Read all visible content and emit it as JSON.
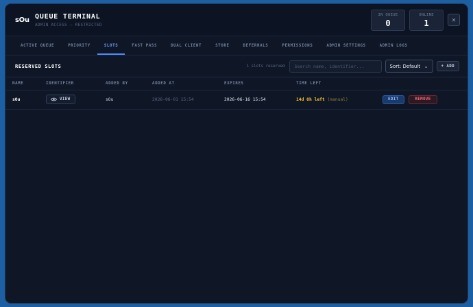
{
  "header": {
    "logo": "sOu",
    "title": "QUEUE TERMINAL",
    "subtitle": "ADMIN ACCESS — RESTRICTED",
    "stats": [
      {
        "label": "IN QUEUE",
        "value": "0"
      },
      {
        "label": "ONLINE",
        "value": "1"
      }
    ],
    "close_glyph": "✕"
  },
  "tabs": [
    {
      "label": "ACTIVE QUEUE",
      "active": false
    },
    {
      "label": "PRIORITY",
      "active": false
    },
    {
      "label": "SLOTS",
      "active": true
    },
    {
      "label": "FAST PASS",
      "active": false
    },
    {
      "label": "DUAL CLIENT",
      "active": false
    },
    {
      "label": "STORE",
      "active": false
    },
    {
      "label": "DEFERRALS",
      "active": false
    },
    {
      "label": "PERMISSIONS",
      "active": false
    },
    {
      "label": "ADMIN SETTINGS",
      "active": false
    },
    {
      "label": "ADMIN LOGS",
      "active": false
    }
  ],
  "panel": {
    "title": "RESERVED SLOTS",
    "count": "1 slots reserved",
    "search_placeholder": "Search name, identifier...",
    "sort_value": "Sort: Default",
    "add_label": "+ ADD"
  },
  "table": {
    "columns": [
      "NAME",
      "IDENTIFIER",
      "ADDED BY",
      "ADDED AT",
      "EXPIRES",
      "TIME LEFT",
      ""
    ],
    "rows": [
      {
        "name": "sOu",
        "identifier_button": "VIEW",
        "added_by": "sOu",
        "added_at": "2026-06-01 15:54",
        "expires": "2026-06-16 15:54",
        "time_left": "14d 0h left",
        "time_left_note": "(manual)",
        "edit_label": "EDIT",
        "remove_label": "REMOVE"
      }
    ]
  },
  "colors": {
    "background": "#1d5fa3",
    "window": "#0f1727",
    "accent": "#4d8dff",
    "warning": "#f2c230",
    "danger": "#ff6677"
  },
  "icons": {
    "view": "eye-icon",
    "sort_caret": "chevron-down-icon",
    "close": "close-icon"
  }
}
